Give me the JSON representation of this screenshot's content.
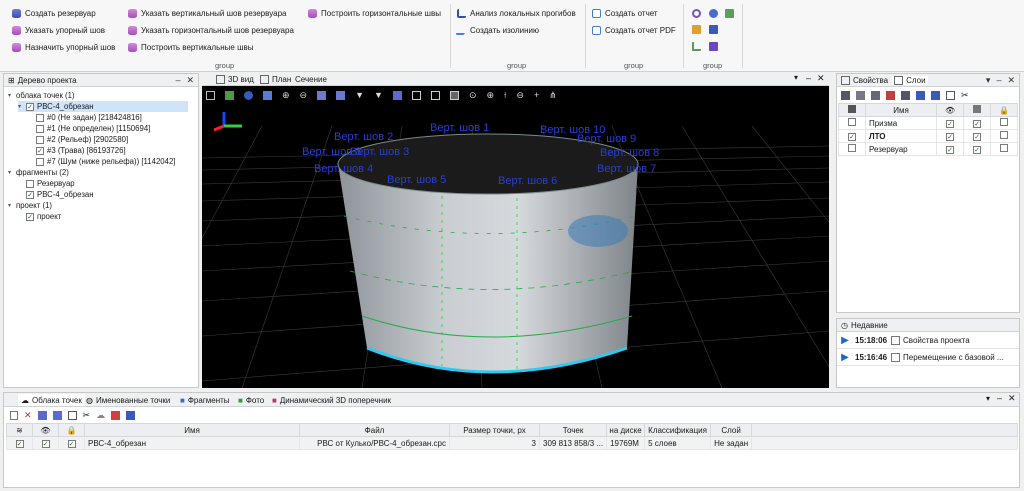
{
  "ribbon": {
    "col1": [
      "Создать резервуар",
      "Указать упорный шов",
      "Назначить упорный шов"
    ],
    "col2": [
      "Указать вертикальный шов резервуара",
      "Указать горизонтальный шов резервуара",
      "Построить вертикальные швы"
    ],
    "col3": [
      "Построить горизонтальные швы"
    ],
    "col4": [
      "Анализ локальных прогибов",
      "Создать изолинию"
    ],
    "col5": [
      "Создать отчет",
      "Создать отчет PDF"
    ],
    "group_labels": [
      "group",
      "group",
      "group",
      "group"
    ]
  },
  "tree_panel": {
    "title": "Дерево проекта",
    "rows": [
      {
        "label": "облака точек (1)",
        "level": 0,
        "twisty": "▾",
        "checkbox": false
      },
      {
        "label": "РВС-4_обрезан",
        "level": 1,
        "twisty": "▾",
        "checkbox": true,
        "checked": true,
        "selected": true
      },
      {
        "label": "#0 (Не задан) [218424816]",
        "level": 2,
        "checkbox": true,
        "checked": false
      },
      {
        "label": "#1 (Не определен) [1150694]",
        "level": 2,
        "checkbox": true,
        "checked": false
      },
      {
        "label": "#2 (Рельеф) [2902580]",
        "level": 2,
        "checkbox": true,
        "checked": false
      },
      {
        "label": "#3 (Трава) [86193726]",
        "level": 2,
        "checkbox": true,
        "checked": true
      },
      {
        "label": "#7 (Шум (ниже рельефа)) [1142042]",
        "level": 2,
        "checkbox": true,
        "checked": false
      },
      {
        "label": "фрагменты (2)",
        "level": 0,
        "twisty": "▾",
        "checkbox": false
      },
      {
        "label": "Резервуар",
        "level": 1,
        "checkbox": true,
        "checked": false
      },
      {
        "label": "РВС-4_обрезан",
        "level": 1,
        "checkbox": true,
        "checked": true
      },
      {
        "label": "проект (1)",
        "level": 0,
        "twisty": "▾",
        "checkbox": false
      },
      {
        "label": "проект",
        "level": 1,
        "checkbox": true,
        "checked": true
      }
    ]
  },
  "view_tabs": {
    "tab_3d": "3D вид",
    "tab_plan": "План",
    "tab_section": "Сечение"
  },
  "viewport_labels": [
    "Верт. шов 2",
    "Верт. шов 1",
    "Верт. шов 10",
    "Верт. шов 3",
    "Верт. шов 9",
    "Верт. шов 3",
    "Верт. шов 8",
    "Верт. шов 4",
    "Верт. шов 7",
    "Верт. шов 5",
    "Верт. шов 6"
  ],
  "right_panel": {
    "tab_props": "Свойства",
    "tab_layers": "Слои",
    "columns": {
      "name": "Имя"
    },
    "layers": [
      {
        "name": "Призма",
        "bold": false,
        "c1": false,
        "c2": true,
        "c3": true,
        "c4": false
      },
      {
        "name": "ЛТО",
        "bold": true,
        "c1": true,
        "c2": true,
        "c3": true,
        "c4": false
      },
      {
        "name": "Резервуар",
        "bold": false,
        "c1": false,
        "c2": true,
        "c3": true,
        "c4": false
      }
    ]
  },
  "recent": {
    "title": "Недавние",
    "items": [
      {
        "time": "15:18:06",
        "text": "Свойства проекта"
      },
      {
        "time": "15:16:46",
        "text": "Перемещение с базовой ..."
      }
    ]
  },
  "bottom_tabs": [
    "Облака точек",
    "Именованные точки",
    "Фрагменты",
    "Фото",
    "Динамический 3D поперечник"
  ],
  "bottom_table": {
    "headers": [
      "Имя",
      "Файл",
      "Размер точки, px",
      "Точек",
      "на диске",
      "Классификация",
      "Слой"
    ],
    "rows": [
      [
        "РВС-4_обрезан",
        "РВС от Кулько/РВС-4_обрезан.cpc",
        "3",
        "309 813 858/3 ...",
        "19769M",
        "5 слоев",
        "Не задан"
      ]
    ]
  }
}
